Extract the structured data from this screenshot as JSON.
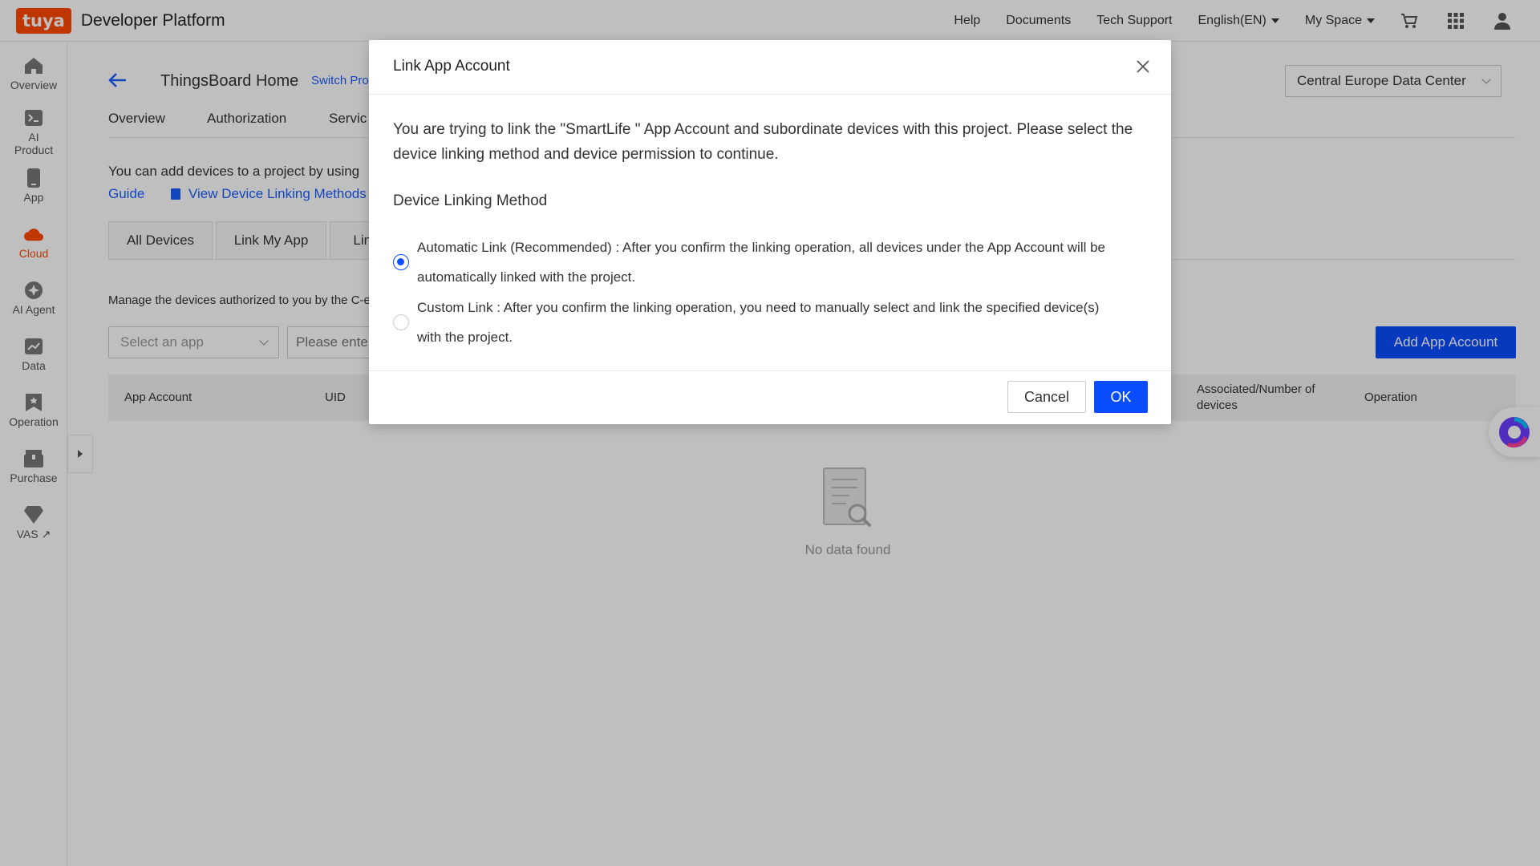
{
  "topbar": {
    "logo": "tuya",
    "platform_name": "Developer Platform",
    "nav": {
      "help": "Help",
      "documents": "Documents",
      "tech_support": "Tech Support",
      "language": "English(EN)",
      "my_space": "My Space"
    }
  },
  "sidebar": {
    "items": [
      {
        "label": "Overview",
        "icon": "home-icon"
      },
      {
        "label": "AI Product",
        "icon": "terminal-icon"
      },
      {
        "label": "App",
        "icon": "phone-icon"
      },
      {
        "label": "Cloud",
        "icon": "cloud-icon",
        "active": true
      },
      {
        "label": "AI Agent",
        "icon": "sparkle-icon"
      },
      {
        "label": "Data",
        "icon": "chart-icon"
      },
      {
        "label": "Operation",
        "icon": "bookmark-icon"
      },
      {
        "label": "Purchase",
        "icon": "box-icon"
      },
      {
        "label": "VAS",
        "icon": "gem-icon",
        "external": "↗"
      }
    ]
  },
  "project": {
    "title": "ThingsBoard Home",
    "switch_label": "Switch Pro",
    "data_center": "Central Europe Data Center"
  },
  "tabs": [
    "Overview",
    "Authorization",
    "Servic"
  ],
  "intro": {
    "text": "You can add devices to a project by using",
    "guide": "Guide",
    "methods": "View Device Linking Methods"
  },
  "subtabs": [
    "All Devices",
    "Link My App",
    "Link"
  ],
  "manage": {
    "text": "Manage the devices authorized to you by the C-e",
    "app_select_placeholder": "Select an app",
    "search_placeholder": "Please ente",
    "add_button": "Add App Account"
  },
  "table": {
    "headers": {
      "app_account": "App Account",
      "uid": "UID",
      "associated": "Associated/Number of devices",
      "operation": "Operation"
    },
    "empty_text": "No data found"
  },
  "modal": {
    "title": "Link App Account",
    "message": "You are trying to link the \"SmartLife \" App Account and subordinate devices with this project. Please select the device linking method and device permission to continue.",
    "method_heading": "Device Linking Method",
    "options": [
      {
        "text": "Automatic Link (Recommended) : After you confirm the linking operation, all devices under the App Account will be automatically linked with the project.",
        "checked": true
      },
      {
        "text": "Custom Link : After you confirm the linking operation, you need to manually select and link the specified device(s) with the project.",
        "checked": false
      }
    ],
    "cancel": "Cancel",
    "ok": "OK"
  },
  "colors": {
    "brand": "#ff4800",
    "primary": "#0a4cff",
    "link": "#1a5cff"
  }
}
